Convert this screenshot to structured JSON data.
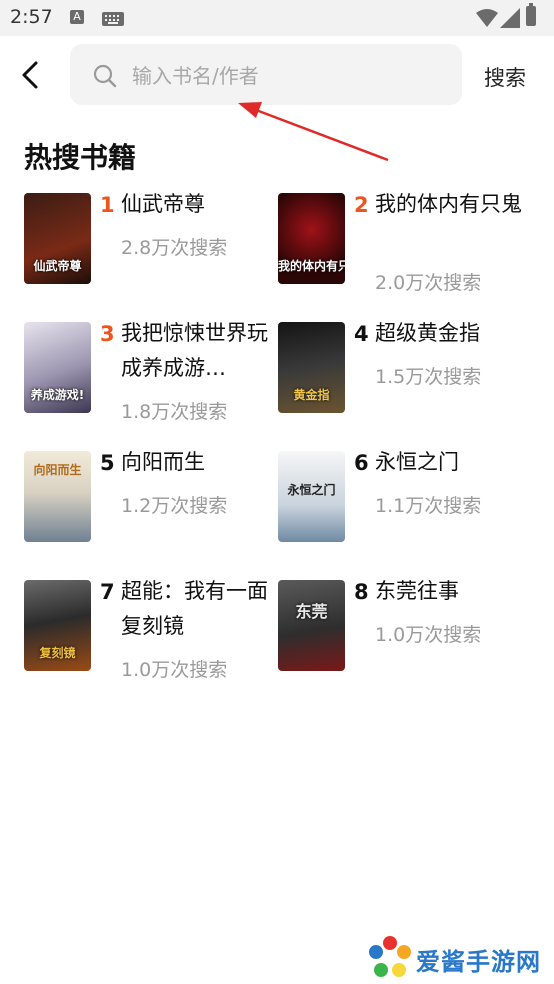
{
  "status_bar": {
    "time": "2:57",
    "a_badge": "A"
  },
  "header": {
    "search_placeholder": "输入书名/作者",
    "search_label": "搜索"
  },
  "section_title": "热搜书籍",
  "books": [
    {
      "rank": "1",
      "title": "仙武帝尊",
      "count": "2.8万次搜索",
      "cover_text": "仙武帝尊",
      "cover_colors": [
        "#3a1d14",
        "#7a2a16"
      ]
    },
    {
      "rank": "2",
      "title": "我的体内有只鬼",
      "count": "2.0万次搜索",
      "cover_text": "我的体内有只鬼",
      "cover_colors": [
        "#1a0a0a",
        "#7a0d12"
      ]
    },
    {
      "rank": "3",
      "title": "我把惊悚世界玩成养成游…",
      "count": "1.8万次搜索",
      "cover_text": "养成游戏!",
      "cover_colors": [
        "#c9c3d6",
        "#4a4560"
      ]
    },
    {
      "rank": "4",
      "title": "超级黄金指",
      "count": "1.5万次搜索",
      "cover_text": "黄金指",
      "cover_colors": [
        "#101010",
        "#55432a"
      ]
    },
    {
      "rank": "5",
      "title": "向阳而生",
      "count": "1.2万次搜索",
      "cover_text": "向阳而生",
      "cover_colors": [
        "#efe6d2",
        "#7f8f9f"
      ]
    },
    {
      "rank": "6",
      "title": "永恒之门",
      "count": "1.1万次搜索",
      "cover_text": "永恒之门",
      "cover_colors": [
        "#f2f2f2",
        "#8ea3b8"
      ]
    },
    {
      "rank": "7",
      "title": "超能：我有一面复刻镜",
      "count": "1.0万次搜索",
      "cover_text": "复刻镜",
      "cover_colors": [
        "#2b2b2b",
        "#8a4a1a"
      ]
    },
    {
      "rank": "8",
      "title": "东莞往事",
      "count": "1.0万次搜索",
      "cover_text": "东莞",
      "cover_colors": [
        "#3b3b3b",
        "#a02020"
      ]
    }
  ],
  "watermark": {
    "text": "爱酱手游网"
  },
  "colors": {
    "hot_rank": "#f0541e",
    "annotation_arrow": "#e02a2a"
  }
}
